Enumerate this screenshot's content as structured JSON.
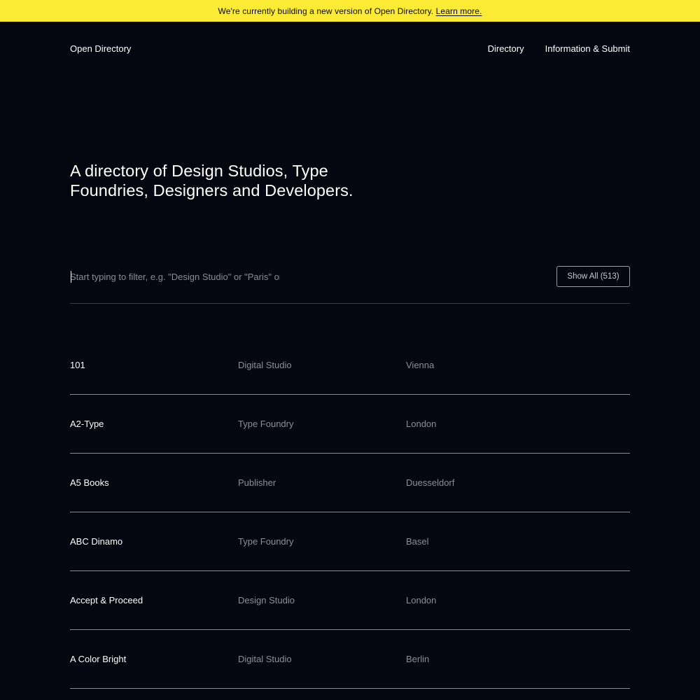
{
  "banner": {
    "text": "We're currently building a new version of Open Directory.",
    "link_label": "Learn more."
  },
  "header": {
    "brand": "Open Directory",
    "nav": [
      {
        "label": "Directory"
      },
      {
        "label": "Information & Submit"
      }
    ]
  },
  "hero": {
    "title": "A directory of Design Studios, Type Foundries, Designers and Developers."
  },
  "filter": {
    "value": "",
    "placeholder": "Start typing to filter, e.g. \"Design Studio\" or \"Paris\" or \"Type Foundry\"",
    "show_all_label": "Show All (513)"
  },
  "entries": [
    {
      "name": "101",
      "type": "Digital Studio",
      "city": "Vienna"
    },
    {
      "name": "A2-Type",
      "type": "Type Foundry",
      "city": "London"
    },
    {
      "name": "A5 Books",
      "type": "Publisher",
      "city": "Duesseldorf"
    },
    {
      "name": "ABC Dinamo",
      "type": "Type Foundry",
      "city": "Basel"
    },
    {
      "name": "Accept & Proceed",
      "type": "Design Studio",
      "city": "London"
    },
    {
      "name": "A Color Bright",
      "type": "Digital Studio",
      "city": "Berlin"
    }
  ],
  "colors": {
    "banner_background": "#fbeb34",
    "page_background": "#05060f",
    "primary_text": "#ffffff",
    "secondary_text": "#8e8f97"
  }
}
